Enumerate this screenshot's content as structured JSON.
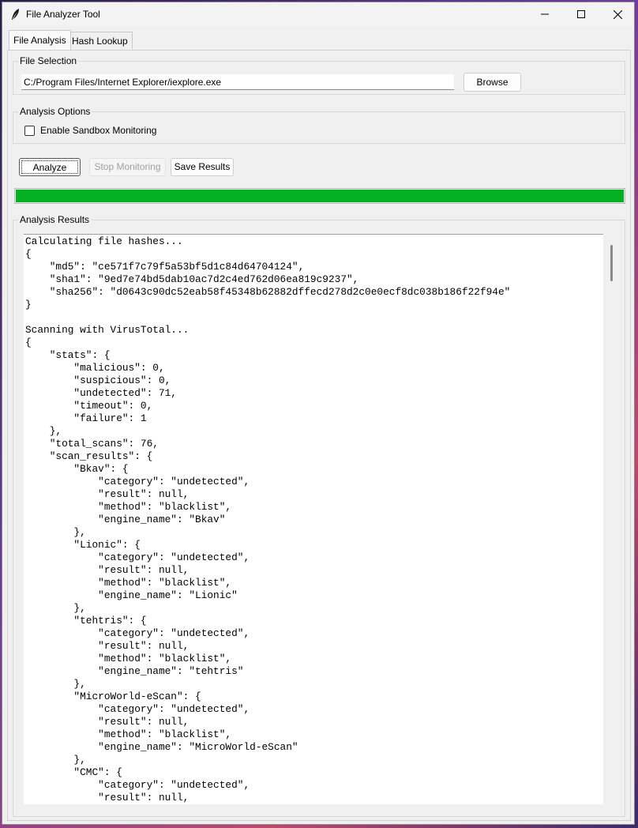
{
  "window": {
    "title": "File Analyzer Tool",
    "controls": [
      "minimize",
      "maximize",
      "close"
    ]
  },
  "tabs": [
    {
      "label": "File Analysis",
      "active": true
    },
    {
      "label": "Hash Lookup",
      "active": false
    }
  ],
  "file_selection": {
    "group_label": "File Selection",
    "path_value": "C:/Program Files/Internet Explorer/iexplore.exe",
    "browse_label": "Browse"
  },
  "analysis_options": {
    "group_label": "Analysis Options",
    "sandbox_label": "Enable Sandbox Monitoring",
    "sandbox_checked": false
  },
  "actions": {
    "analyze_label": "Analyze",
    "stop_label": "Stop Monitoring",
    "stop_enabled": false,
    "save_label": "Save Results"
  },
  "progress": {
    "value": 1.0,
    "color": "#06b025"
  },
  "results": {
    "group_label": "Analysis Results",
    "text": "Calculating file hashes...\n{\n    \"md5\": \"ce571f7c79f5a53bf5d1c84d64704124\",\n    \"sha1\": \"9ed7e74bd5dab10ac7d2c4ed762d06ea819c9237\",\n    \"sha256\": \"d0643c90dc52eab58f45348b62882dffecd278d2c0e0ecf8dc038b186f22f94e\"\n}\n\nScanning with VirusTotal...\n{\n    \"stats\": {\n        \"malicious\": 0,\n        \"suspicious\": 0,\n        \"undetected\": 71,\n        \"timeout\": 0,\n        \"failure\": 1\n    },\n    \"total_scans\": 76,\n    \"scan_results\": {\n        \"Bkav\": {\n            \"category\": \"undetected\",\n            \"result\": null,\n            \"method\": \"blacklist\",\n            \"engine_name\": \"Bkav\"\n        },\n        \"Lionic\": {\n            \"category\": \"undetected\",\n            \"result\": null,\n            \"method\": \"blacklist\",\n            \"engine_name\": \"Lionic\"\n        },\n        \"tehtris\": {\n            \"category\": \"undetected\",\n            \"result\": null,\n            \"method\": \"blacklist\",\n            \"engine_name\": \"tehtris\"\n        },\n        \"MicroWorld-eScan\": {\n            \"category\": \"undetected\",\n            \"result\": null,\n            \"method\": \"blacklist\",\n            \"engine_name\": \"MicroWorld-eScan\"\n        },\n        \"CMC\": {\n            \"category\": \"undetected\",\n            \"result\": null,"
  }
}
